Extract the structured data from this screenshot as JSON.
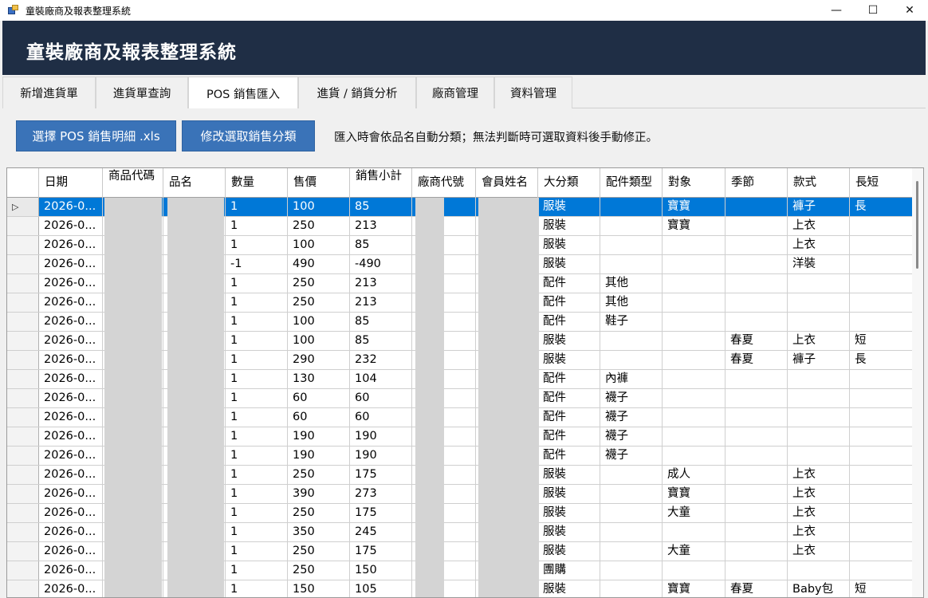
{
  "window": {
    "title": "童裝廠商及報表整理系統",
    "minimize": "—",
    "maximize": "☐",
    "close": "✕"
  },
  "header": {
    "title": "童裝廠商及報表整理系統"
  },
  "tabs": [
    {
      "label": "新增進貨單"
    },
    {
      "label": "進貨單查詢"
    },
    {
      "label": "POS 銷售匯入"
    },
    {
      "label": "進貨 / 銷貨分析"
    },
    {
      "label": "廠商管理"
    },
    {
      "label": "資料管理"
    }
  ],
  "toolbar": {
    "select_xls": "選擇 POS 銷售明細 .xls",
    "edit_category": "修改選取銷售分類",
    "hint": "匯入時會依品名自動分類；無法判斷時可選取資料後手動修正。"
  },
  "grid": {
    "columns": [
      "日期",
      "商品代碼",
      "品名",
      "數量",
      "售價",
      "銷售小計",
      "廠商代號",
      "會員姓名",
      "大分類",
      "配件類型",
      "對象",
      "季節",
      "款式",
      "長短"
    ],
    "selected_row": 0,
    "rows": [
      [
        "2026-0...",
        "",
        "",
        "1",
        "100",
        "85",
        "",
        "",
        "服裝",
        "",
        "寶寶",
        "",
        "褲子",
        "長"
      ],
      [
        "2026-0...",
        "",
        "",
        "1",
        "250",
        "213",
        "",
        "",
        "服裝",
        "",
        "寶寶",
        "",
        "上衣",
        ""
      ],
      [
        "2026-0...",
        "",
        "",
        "1",
        "100",
        "85",
        "",
        "",
        "服裝",
        "",
        "",
        "",
        "上衣",
        ""
      ],
      [
        "2026-0...",
        "",
        "",
        "-1",
        "490",
        "-490",
        "",
        "",
        "服裝",
        "",
        "",
        "",
        "洋裝",
        ""
      ],
      [
        "2026-0...",
        "",
        "",
        "1",
        "250",
        "213",
        "",
        "",
        "配件",
        "其他",
        "",
        "",
        "",
        ""
      ],
      [
        "2026-0...",
        "",
        "",
        "1",
        "250",
        "213",
        "",
        "",
        "配件",
        "其他",
        "",
        "",
        "",
        ""
      ],
      [
        "2026-0...",
        "",
        "",
        "1",
        "100",
        "85",
        "",
        "",
        "配件",
        "鞋子",
        "",
        "",
        "",
        ""
      ],
      [
        "2026-0...",
        "",
        "",
        "1",
        "100",
        "85",
        "",
        "",
        "服裝",
        "",
        "",
        "春夏",
        "上衣",
        "短"
      ],
      [
        "2026-0...",
        "",
        "",
        "1",
        "290",
        "232",
        "",
        "",
        "服裝",
        "",
        "",
        "春夏",
        "褲子",
        "長"
      ],
      [
        "2026-0...",
        "",
        "",
        "1",
        "130",
        "104",
        "",
        "",
        "配件",
        "內褲",
        "",
        "",
        "",
        ""
      ],
      [
        "2026-0...",
        "",
        "",
        "1",
        "60",
        "60",
        "",
        "",
        "配件",
        "襪子",
        "",
        "",
        "",
        ""
      ],
      [
        "2026-0...",
        "",
        "",
        "1",
        "60",
        "60",
        "",
        "",
        "配件",
        "襪子",
        "",
        "",
        "",
        ""
      ],
      [
        "2026-0...",
        "",
        "",
        "1",
        "190",
        "190",
        "",
        "",
        "配件",
        "襪子",
        "",
        "",
        "",
        ""
      ],
      [
        "2026-0...",
        "",
        "",
        "1",
        "190",
        "190",
        "",
        "",
        "配件",
        "襪子",
        "",
        "",
        "",
        ""
      ],
      [
        "2026-0...",
        "",
        "",
        "1",
        "250",
        "175",
        "",
        "",
        "服裝",
        "",
        "成人",
        "",
        "上衣",
        ""
      ],
      [
        "2026-0...",
        "",
        "",
        "1",
        "390",
        "273",
        "",
        "",
        "服裝",
        "",
        "寶寶",
        "",
        "上衣",
        ""
      ],
      [
        "2026-0...",
        "",
        "",
        "1",
        "250",
        "175",
        "",
        "",
        "服裝",
        "",
        "大童",
        "",
        "上衣",
        ""
      ],
      [
        "2026-0...",
        "",
        "",
        "1",
        "350",
        "245",
        "",
        "",
        "服裝",
        "",
        "",
        "",
        "上衣",
        ""
      ],
      [
        "2026-0...",
        "",
        "",
        "1",
        "250",
        "175",
        "",
        "",
        "服裝",
        "",
        "大童",
        "",
        "上衣",
        ""
      ],
      [
        "2026-0...",
        "",
        "",
        "1",
        "250",
        "150",
        "",
        "",
        "團購",
        "",
        "",
        "",
        "",
        ""
      ],
      [
        "2026-0...",
        "",
        "",
        "1",
        "150",
        "105",
        "",
        "",
        "服裝",
        "",
        "寶寶",
        "春夏",
        "Baby包",
        "短"
      ]
    ]
  }
}
